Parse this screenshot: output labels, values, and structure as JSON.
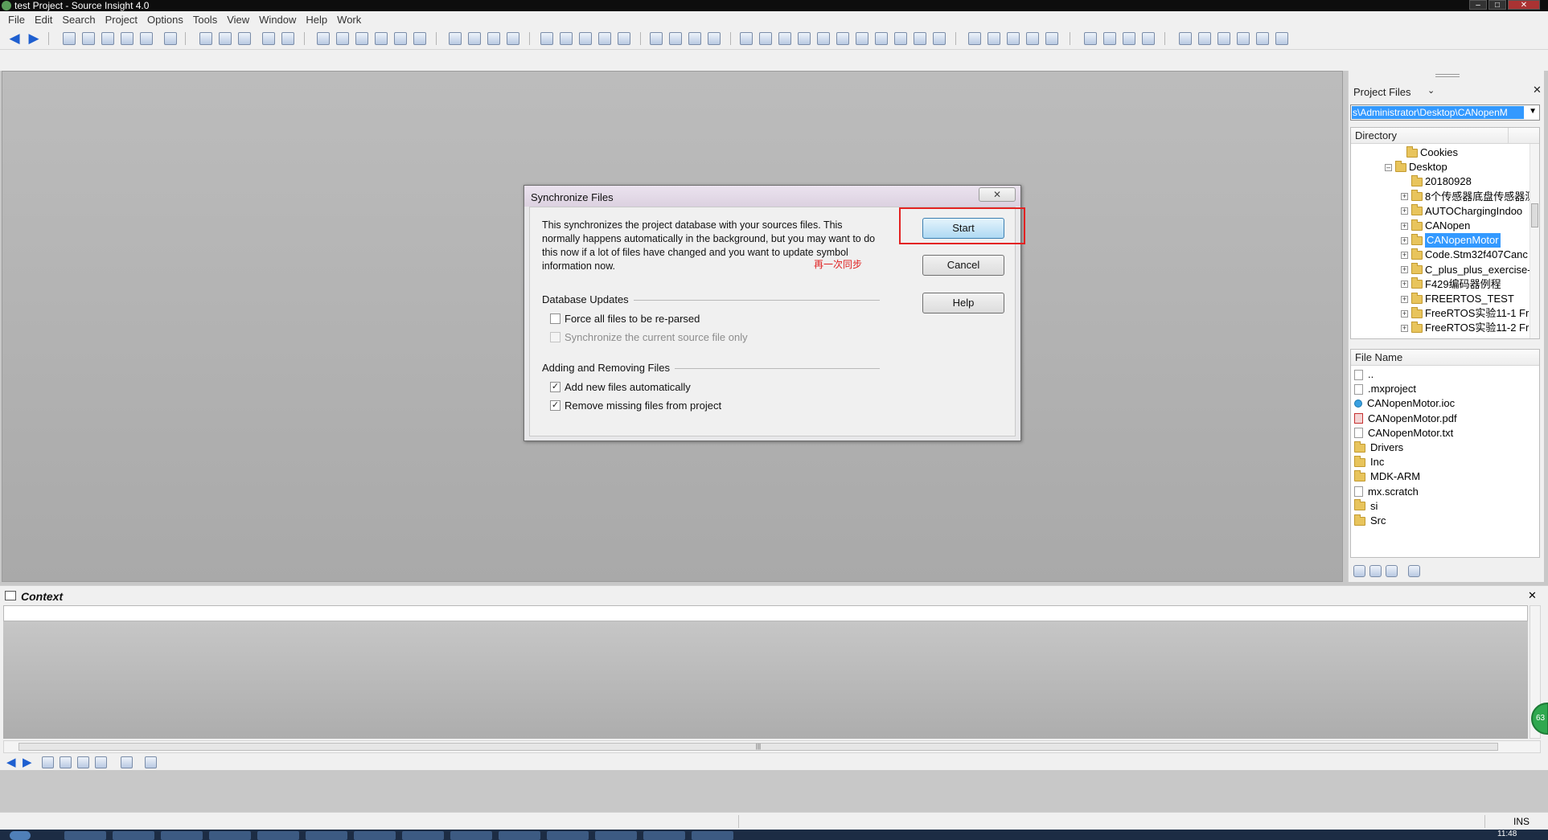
{
  "window": {
    "title": "test Project - Source Insight 4.0",
    "controls": [
      "–",
      "□",
      "✕"
    ]
  },
  "menubar": [
    "File",
    "Edit",
    "Search",
    "Project",
    "Options",
    "Tools",
    "View",
    "Window",
    "Help",
    "Work"
  ],
  "dialog": {
    "title": "Synchronize Files",
    "close_glyph": "✕",
    "description": "This synchronizes the project database with your sources files. This normally happens automatically in the background, but you may want to do this now if a lot of files have changed and you want to update symbol information now.",
    "database_updates": {
      "label": "Database Updates",
      "force_reparse": {
        "label": "Force all files to be re-parsed",
        "checked": false,
        "enabled": true
      },
      "sync_current_only": {
        "label": "Synchronize the current source file only",
        "checked": false,
        "enabled": false
      }
    },
    "adding_removing": {
      "label": "Adding and Removing Files",
      "add_new": {
        "label": "Add new files automatically",
        "checked": true,
        "enabled": true
      },
      "remove_missing": {
        "label": "Remove missing files from project",
        "checked": true,
        "enabled": true
      }
    },
    "buttons": {
      "start": "Start",
      "cancel": "Cancel",
      "help": "Help"
    },
    "annotation": "再一次同步"
  },
  "project_panel": {
    "title": "Project Files",
    "dropdown_glyph": "⌄",
    "close_glyph": "✕",
    "path": "s\\Administrator\\Desktop\\CANopenM",
    "directory_header": "Directory",
    "directories": [
      {
        "label": "Cookies",
        "expander": ""
      },
      {
        "label": "Desktop",
        "expander": "–"
      },
      {
        "label": "20180928",
        "expander": ""
      },
      {
        "label": "8个传感器底盘传感器测",
        "expander": "+"
      },
      {
        "label": "AUTOChargingIndoo",
        "expander": "+"
      },
      {
        "label": "CANopen",
        "expander": "+"
      },
      {
        "label": "CANopenMotor",
        "expander": "+",
        "selected": true
      },
      {
        "label": "Code.Stm32f407Canc",
        "expander": "+"
      },
      {
        "label": "C_plus_plus_exercise-",
        "expander": "+"
      },
      {
        "label": "F429编码器例程",
        "expander": "+"
      },
      {
        "label": "FREERTOS_TEST",
        "expander": "+"
      },
      {
        "label": "FreeRTOS实验11-1 Fr",
        "expander": "+"
      },
      {
        "label": "FreeRTOS实验11-2 Fr",
        "expander": "+"
      }
    ],
    "file_header": "File Name",
    "files": [
      {
        "label": "..",
        "type": "file"
      },
      {
        "label": ".mxproject",
        "type": "file"
      },
      {
        "label": "CANopenMotor.ioc",
        "type": "ioc"
      },
      {
        "label": "CANopenMotor.pdf",
        "type": "pdf"
      },
      {
        "label": "CANopenMotor.txt",
        "type": "file"
      },
      {
        "label": "Drivers",
        "type": "folder"
      },
      {
        "label": "Inc",
        "type": "folder"
      },
      {
        "label": "MDK-ARM",
        "type": "folder"
      },
      {
        "label": "mx.scratch",
        "type": "file"
      },
      {
        "label": "si",
        "type": "folder"
      },
      {
        "label": "Src",
        "type": "folder"
      }
    ]
  },
  "context_panel": {
    "title": "Context",
    "close_glyph": "✕",
    "hscroll_grip": "|||"
  },
  "statusbar": {
    "mode": "INS"
  },
  "taskbar": {
    "clock": "11:48"
  },
  "side_badge": "63"
}
